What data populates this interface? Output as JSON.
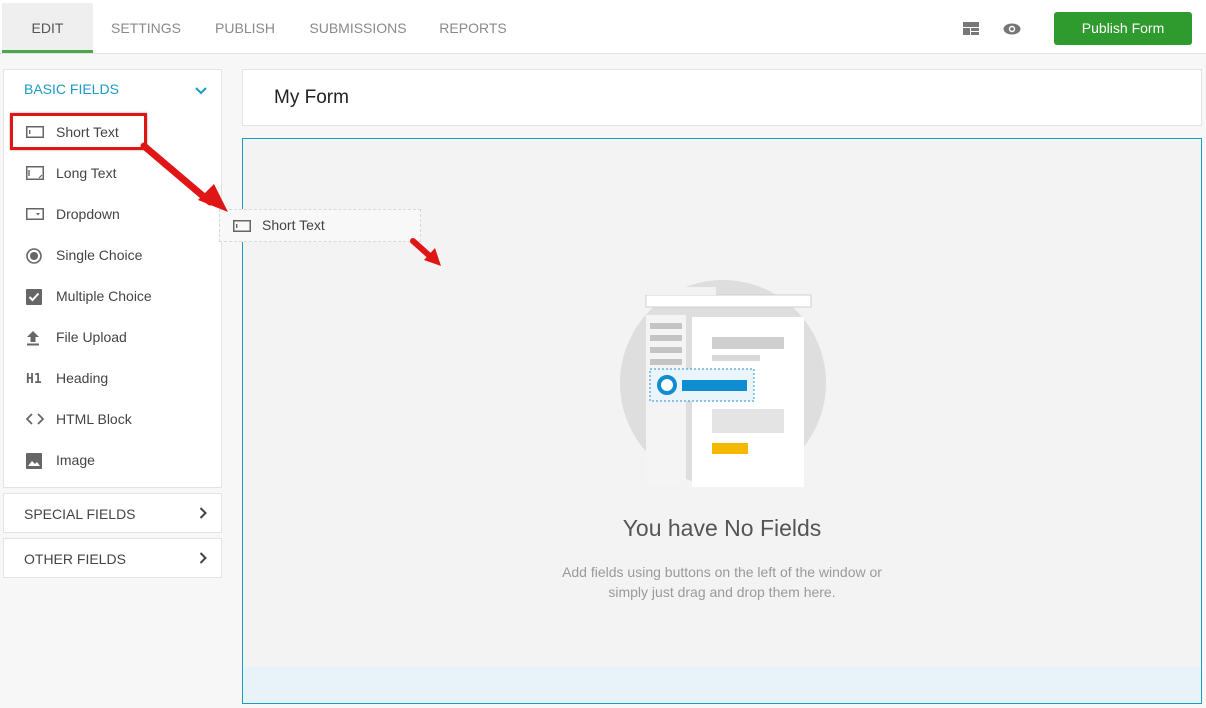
{
  "nav": {
    "tabs": [
      "EDIT",
      "SETTINGS",
      "PUBLISH",
      "SUBMISSIONS",
      "REPORTS"
    ],
    "active_tab": "EDIT",
    "publish_label": "Publish Form",
    "icons": [
      "layout-icon",
      "eye-icon"
    ]
  },
  "sidebar": {
    "basic": {
      "title": "BASIC FIELDS",
      "items": [
        {
          "label": "Short Text",
          "icon": "short-text-icon"
        },
        {
          "label": "Long Text",
          "icon": "long-text-icon"
        },
        {
          "label": "Dropdown",
          "icon": "dropdown-icon"
        },
        {
          "label": "Single Choice",
          "icon": "radio-icon"
        },
        {
          "label": "Multiple Choice",
          "icon": "checkbox-icon"
        },
        {
          "label": "File Upload",
          "icon": "upload-icon"
        },
        {
          "label": "Heading",
          "icon": "h1-icon"
        },
        {
          "label": "HTML Block",
          "icon": "code-icon"
        },
        {
          "label": "Image",
          "icon": "image-icon"
        }
      ]
    },
    "special": {
      "title": "SPECIAL FIELDS"
    },
    "other": {
      "title": "OTHER FIELDS"
    }
  },
  "drag": {
    "label": "Short Text"
  },
  "form": {
    "title": "My Form",
    "empty_title": "You have No Fields",
    "empty_desc_line1": "Add fields using buttons on the left of the window or",
    "empty_desc_line2": "simply just drag and drop them here."
  },
  "colors": {
    "accent": "#1a9bc4",
    "publish": "#2f9a2d",
    "annotation": "#e01616"
  }
}
